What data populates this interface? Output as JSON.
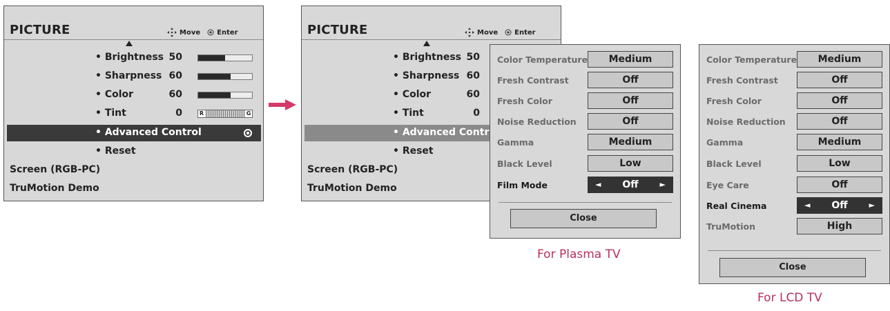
{
  "left_menu": {
    "title": "PICTURE",
    "hint_move": "Move",
    "hint_enter": "Enter",
    "items": [
      {
        "label": "• Brightness",
        "value": "50",
        "level": 0.5
      },
      {
        "label": "• Sharpness",
        "value": "60",
        "level": 0.6
      },
      {
        "label": "• Color",
        "value": "60",
        "level": 0.6
      },
      {
        "label": "• Tint",
        "value": "0",
        "tint_r": "R",
        "tint_g": "G"
      },
      {
        "label": "• Advanced Control"
      },
      {
        "label": "• Reset"
      }
    ],
    "screen": "Screen (RGB-PC)",
    "trumotion": "TruMotion Demo"
  },
  "right_menu": {
    "title": "PICTURE",
    "hint_move": "Move",
    "hint_enter": "Enter",
    "items": [
      {
        "label": "• Brightness",
        "value": "50"
      },
      {
        "label": "• Sharpness",
        "value": "60"
      },
      {
        "label": "• Color",
        "value": "60"
      },
      {
        "label": "• Tint",
        "value": "0"
      },
      {
        "label": "• Advanced Control"
      },
      {
        "label": "• Reset"
      }
    ],
    "screen": "Screen (RGB-PC)",
    "trumotion": "TruMotion Demo"
  },
  "plasma_submenu": {
    "rows": [
      {
        "label": "Color Temperature",
        "value": "Medium"
      },
      {
        "label": "Fresh Contrast",
        "value": "Off"
      },
      {
        "label": "Fresh Color",
        "value": "Off"
      },
      {
        "label": "Noise Reduction",
        "value": "Off"
      },
      {
        "label": "Gamma",
        "value": "Medium"
      },
      {
        "label": "Black Level",
        "value": "Low"
      },
      {
        "label": "Film Mode",
        "value": "Off",
        "active": true
      }
    ],
    "close": "Close",
    "caption": "For Plasma TV"
  },
  "lcd_submenu": {
    "rows": [
      {
        "label": "Color Temperature",
        "value": "Medium"
      },
      {
        "label": "Fresh Contrast",
        "value": "Off"
      },
      {
        "label": "Fresh Color",
        "value": "Off"
      },
      {
        "label": "Noise Reduction",
        "value": "Off"
      },
      {
        "label": "Gamma",
        "value": "Medium"
      },
      {
        "label": "Black Level",
        "value": "Low"
      },
      {
        "label": "Eye Care",
        "value": "Off"
      },
      {
        "label": "Real Cinema",
        "value": "Off",
        "active": true
      },
      {
        "label": "TruMotion",
        "value": "High"
      }
    ],
    "close": "Close",
    "caption": "For LCD TV"
  },
  "arrows": {
    "left": "◄",
    "right": "►"
  },
  "colors": {
    "accent": "#d43a68",
    "selection": "#3a3a3a",
    "caption": "#b8305c"
  }
}
